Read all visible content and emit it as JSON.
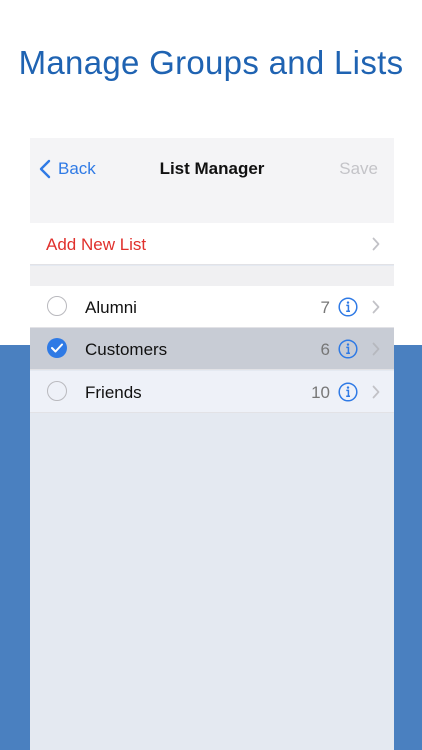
{
  "headline": "Manage Groups and Lists",
  "nav": {
    "back_label": "Back",
    "title": "List Manager",
    "save_label": "Save"
  },
  "add_list_label": "Add New List",
  "lists": [
    {
      "name": "Alumni",
      "count": "7",
      "selected": false
    },
    {
      "name": "Customers",
      "count": "6",
      "selected": true
    },
    {
      "name": "Friends",
      "count": "10",
      "selected": false
    }
  ],
  "colors": {
    "accent": "#2f7ae5",
    "headline": "#1f63b2",
    "destructive": "#e0302c",
    "band": "#4a80c0"
  },
  "icons": {
    "back": "chevron-left-icon",
    "disclosure": "chevron-right-icon",
    "info": "info-circle-icon",
    "radio": "radio-circle-icon",
    "check": "checkmark-icon"
  }
}
